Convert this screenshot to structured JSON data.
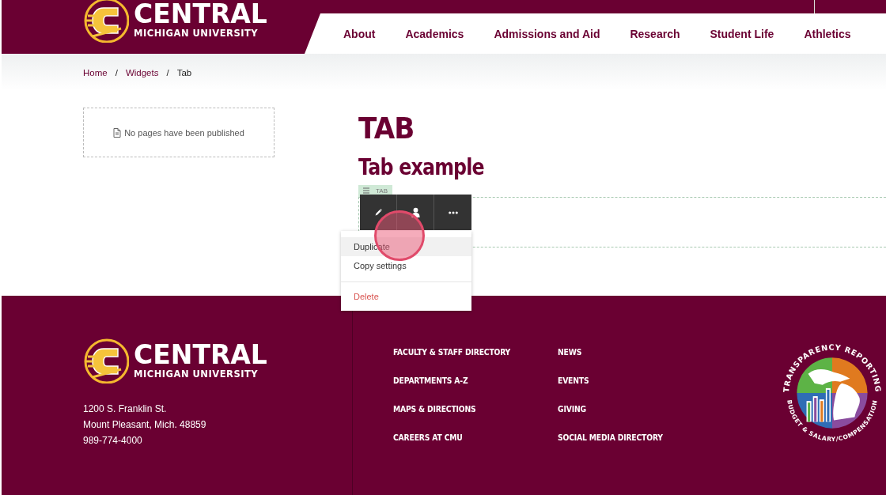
{
  "header": {
    "logo": {
      "wordmark": "CENTRAL",
      "subtitle": "MICHIGAN UNIVERSITY"
    },
    "nav": [
      {
        "label": "About"
      },
      {
        "label": "Academics"
      },
      {
        "label": "Admissions and Aid"
      },
      {
        "label": "Research"
      },
      {
        "label": "Student Life"
      },
      {
        "label": "Athletics"
      }
    ]
  },
  "breadcrumb": {
    "separator": "/",
    "items": [
      {
        "label": "Home",
        "kind": "link"
      },
      {
        "label": "Widgets",
        "kind": "link"
      },
      {
        "label": "Tab",
        "kind": "current"
      }
    ]
  },
  "sidebar": {
    "empty_message": "No pages have been published"
  },
  "main": {
    "title": "TAB",
    "subtitle": "Tab example",
    "widget": {
      "tag": "TAB",
      "toolbar": [
        {
          "kind": "edit"
        },
        {
          "kind": "user"
        },
        {
          "kind": "more"
        }
      ],
      "menu": [
        {
          "label": "Duplicate",
          "kind": "normal",
          "selected": true
        },
        {
          "label": "Copy settings",
          "kind": "normal",
          "selected": false
        },
        {
          "label": "Delete",
          "kind": "danger",
          "selected": false
        }
      ]
    }
  },
  "footer": {
    "logo": {
      "wordmark": "CENTRAL",
      "subtitle": "MICHIGAN UNIVERSITY"
    },
    "address": [
      "1200 S. Franklin St.",
      "Mount Pleasant, Mich. 48859",
      "989-774-4000"
    ],
    "link_columns": [
      [
        "FACULTY & STAFF DIRECTORY",
        "DEPARTMENTS A-Z",
        "MAPS & DIRECTIONS",
        "CAREERS AT CMU"
      ],
      [
        "NEWS",
        "EVENTS",
        "GIVING",
        "SOCIAL MEDIA DIRECTORY"
      ]
    ],
    "badge": {
      "top_text": "TRANSPARENCY REPORTING",
      "bottom_text": "BUDGET & SALARY/COMPENSATION"
    }
  }
}
